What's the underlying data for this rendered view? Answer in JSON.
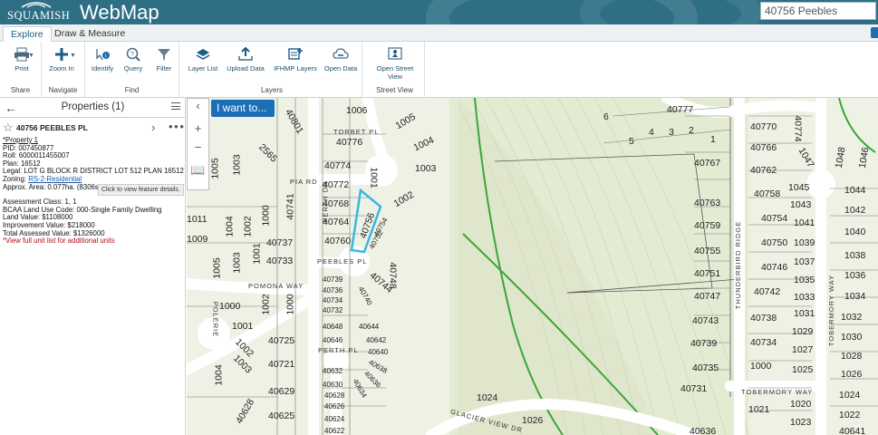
{
  "header": {
    "logo_text": "SQUAMISH",
    "app_title": "WebMap",
    "search_value": "40756 Peebles"
  },
  "tabs": [
    {
      "label": "Explore",
      "active": true
    },
    {
      "label": "Draw & Measure",
      "active": false
    }
  ],
  "ribbon": {
    "share": {
      "label": "Share",
      "tools": [
        "Print"
      ]
    },
    "navigate": {
      "label": "Navigate",
      "tools": [
        "Zoom In"
      ]
    },
    "find": {
      "label": "Find",
      "tools": [
        "Identify",
        "Query",
        "Filter"
      ]
    },
    "layers": {
      "label": "Layers",
      "tools": [
        "Layer List",
        "Upload Data",
        "IFHMP Layers",
        "Open Data"
      ]
    },
    "street_view": {
      "label": "Street View",
      "tools": [
        "Open Street View"
      ]
    }
  },
  "panel": {
    "title": "Properties (1)",
    "feature_name": "40756 PEEBLES PL",
    "attributes": [
      "*Property 1",
      "PID: 007450877",
      "Roll: 6000011455007",
      "Plan: 16512",
      "Legal: LOT G BLOCK R DISTRICT LOT 512 PLAN 16512"
    ],
    "zoning_label": "Zoning: ",
    "zoning_value": "RS-2-Residential",
    "area": "Approx. Area: 0.077ha. (8306s",
    "tooltip": "Click to view feature details.",
    "assessment": [
      "Assessment Class: 1, 1",
      "BCAA Land Use Code: 000-Single Family Dwelling",
      "Land Value: $1108000",
      "Improvement Value: $218000",
      "Total Assessed Value: $1326000"
    ],
    "units_link": "*View full unit list for additional units"
  },
  "map": {
    "i_want_to": "I want to...",
    "tools": [
      "collapse",
      "zoom-in",
      "zoom-out",
      "bookmarks"
    ],
    "roads": [
      "TORBET PL",
      "PIA RD",
      "PERTH DR",
      "PEEBLES PL",
      "POMONA WAY",
      "PERTH PL",
      "GLACIER VIEW DR",
      "THUNDERBIRD RIDGE",
      "TOBERMORY WAY",
      "POLERIE",
      "TOBERMORY WAY"
    ],
    "parcels": [
      "1006",
      "1005",
      "1004",
      "1003",
      "40776",
      "40774",
      "40772",
      "40768",
      "40764",
      "40760",
      "40756",
      "40754",
      "40752",
      "40748",
      "1002",
      "1001",
      "1003",
      "1005",
      "40741",
      "40737",
      "40733",
      "2565",
      "40801",
      "1011",
      "1009",
      "1004",
      "1002",
      "1000",
      "1003",
      "1005",
      "1001",
      "40739",
      "40736",
      "40734",
      "40732",
      "40740",
      "40744",
      "1000",
      "1002",
      "1000",
      "1001",
      "1002",
      "1003",
      "1004",
      "40725",
      "40721",
      "40629",
      "40625",
      "40648",
      "40646",
      "40644",
      "40642",
      "40640",
      "40638",
      "40636",
      "40632",
      "40630",
      "40628",
      "40626",
      "40624",
      "40622",
      "40634",
      "1024",
      "1026",
      "40628",
      "40777",
      "6",
      "5",
      "4",
      "3",
      "2",
      "1",
      "40767",
      "40770",
      "40766",
      "40762",
      "40758",
      "40754",
      "40750",
      "40746",
      "40742",
      "40738",
      "40734",
      "1000",
      "40763",
      "40759",
      "40755",
      "40751",
      "40747",
      "40743",
      "40739",
      "40735",
      "40731",
      "40774",
      "1047",
      "1045",
      "1043",
      "1041",
      "1039",
      "1037",
      "1035",
      "1033",
      "1031",
      "1029",
      "1027",
      "1025",
      "1048",
      "1046",
      "1044",
      "1042",
      "1040",
      "1038",
      "1036",
      "1034",
      "1032",
      "1030",
      "1028",
      "1026",
      "1024",
      "1022",
      "1020",
      "1023",
      "1021",
      "40636",
      "40641",
      "1020"
    ],
    "colors": {
      "accent": "#1a6fb6",
      "header": "#2e6f86",
      "highlight": "#39b7e0",
      "green_line": "#3aa63a"
    }
  }
}
